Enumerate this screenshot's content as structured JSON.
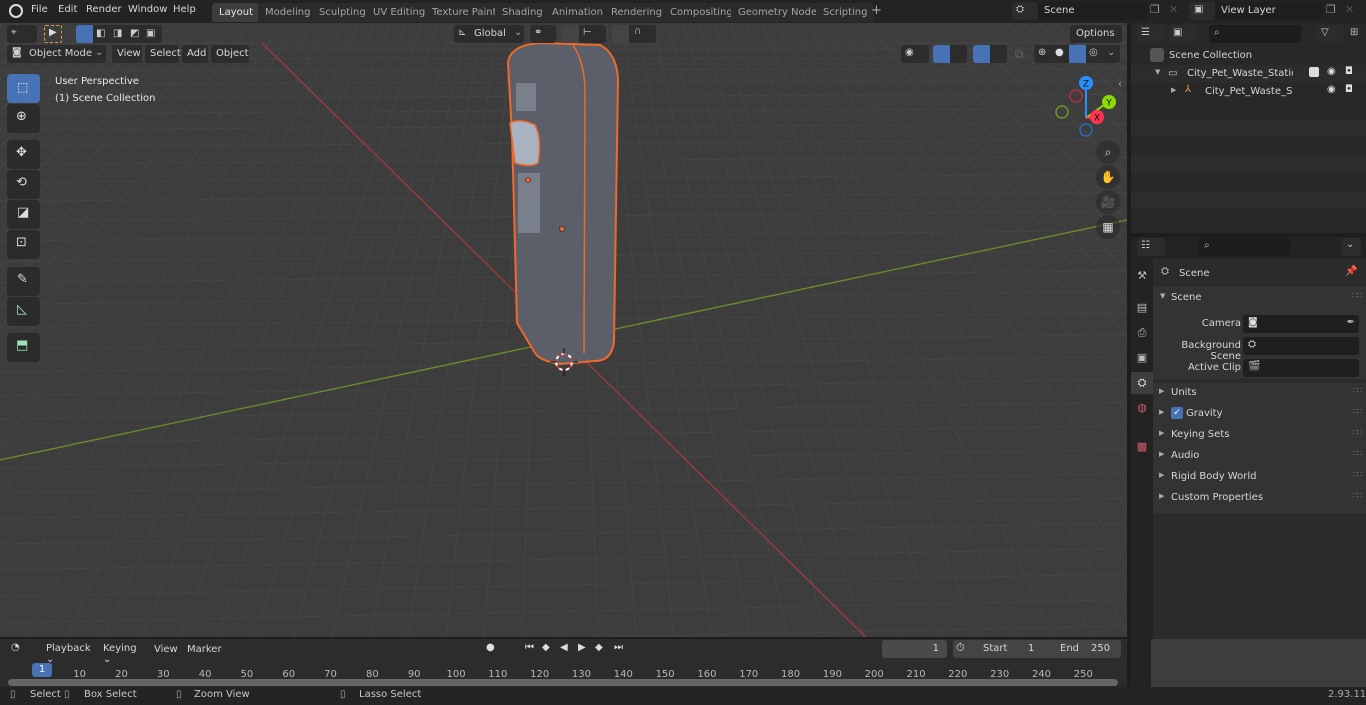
{
  "app": {
    "name": "Blender",
    "version": "2.93.11"
  },
  "menubar": {
    "items": [
      "File",
      "Edit",
      "Render",
      "Window",
      "Help"
    ],
    "workspace_tabs": [
      "Layout",
      "Modeling",
      "Sculpting",
      "UV Editing",
      "Texture Paint",
      "Shading",
      "Animation",
      "Rendering",
      "Compositing",
      "Geometry Nodes",
      "Scripting"
    ],
    "active_tab": "Layout",
    "add_tab": "+",
    "scene_name": "Scene",
    "view_layer_name": "View Layer"
  },
  "viewport_header": {
    "mode": "Object Mode",
    "menus": [
      "View",
      "Select",
      "Add",
      "Object"
    ],
    "transform_orientation": "Global",
    "options_label": "Options"
  },
  "viewport": {
    "view_name": "User Perspective",
    "collection_label": "(1) Scene Collection",
    "object_outline_color": "#f0692b",
    "axis_colors": {
      "x": "#ff3352",
      "y": "#8bdc00",
      "z": "#2890ff"
    },
    "gizmo_labels": {
      "x": "X",
      "y": "Y",
      "z": "Z"
    }
  },
  "outliner": {
    "root": "Scene Collection",
    "items": [
      {
        "name": "City_Pet_Waste_Station_Glass",
        "display": "City_Pet_Waste_Station_Glas",
        "type": "collection",
        "checked": true
      },
      {
        "name": "City_Pet_Waste_Station_",
        "display": "City_Pet_Waste_Station_",
        "type": "object"
      }
    ]
  },
  "properties": {
    "context": "Scene",
    "section": "Scene",
    "fields": [
      {
        "label": "Camera",
        "value": ""
      },
      {
        "label": "Background Scene",
        "value": ""
      },
      {
        "label": "Active Clip",
        "value": ""
      }
    ],
    "panels": [
      {
        "label": "Units"
      },
      {
        "label": "Gravity",
        "checkbox": true,
        "checked": true
      },
      {
        "label": "Keying Sets"
      },
      {
        "label": "Audio"
      },
      {
        "label": "Rigid Body World"
      },
      {
        "label": "Custom Properties"
      }
    ]
  },
  "timeline": {
    "menus": [
      "Playback",
      "Keying",
      "View",
      "Marker"
    ],
    "current_frame": "1",
    "start_label": "Start",
    "start": "1",
    "end_label": "End",
    "end": "250",
    "ticks": [
      "10",
      "20",
      "30",
      "40",
      "50",
      "60",
      "70",
      "80",
      "90",
      "100",
      "110",
      "120",
      "130",
      "140",
      "150",
      "160",
      "170",
      "180",
      "190",
      "200",
      "210",
      "220",
      "230",
      "240",
      "250"
    ],
    "playhead": "1"
  },
  "statusbar": {
    "items": [
      "Select",
      "Box Select",
      "Zoom View",
      "Lasso Select"
    ],
    "version": "2.93.11"
  }
}
